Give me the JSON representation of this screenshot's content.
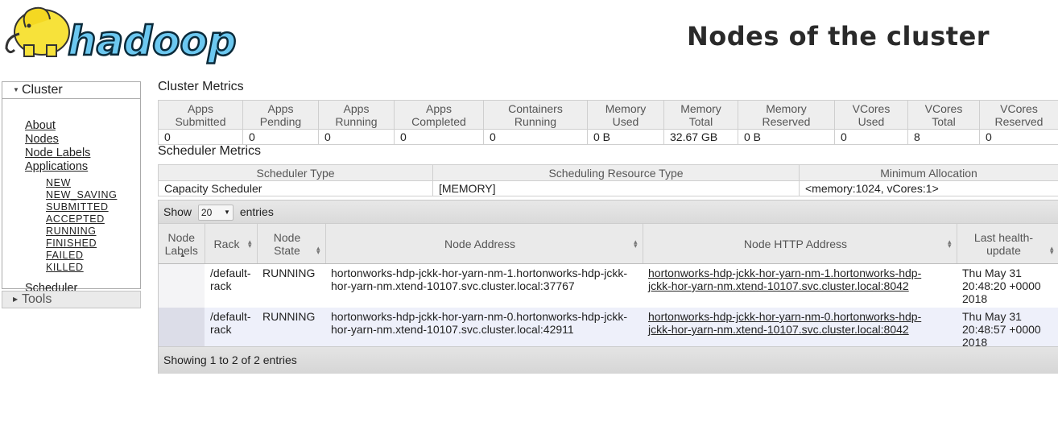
{
  "header": {
    "title": "Nodes of the cluster",
    "logo_text": "hadoop"
  },
  "sidebar": {
    "cluster_label": "Cluster",
    "links": [
      "About",
      "Nodes",
      "Node Labels",
      "Applications"
    ],
    "app_states": [
      "NEW",
      "NEW_SAVING",
      "SUBMITTED",
      "ACCEPTED",
      "RUNNING",
      "FINISHED",
      "FAILED",
      "KILLED"
    ],
    "scheduler_label": "Scheduler",
    "tools_label": "Tools"
  },
  "cluster_metrics": {
    "title": "Cluster Metrics",
    "headers": [
      [
        "Apps",
        "Submitted"
      ],
      [
        "Apps",
        "Pending"
      ],
      [
        "Apps",
        "Running"
      ],
      [
        "Apps",
        "Completed"
      ],
      [
        "Containers",
        "Running"
      ],
      [
        "Memory",
        "Used"
      ],
      [
        "Memory",
        "Total"
      ],
      [
        "Memory",
        "Reserved"
      ],
      [
        "VCores",
        "Used"
      ],
      [
        "VCores",
        "Total"
      ],
      [
        "VCores",
        "Reserved"
      ]
    ],
    "values": [
      "0",
      "0",
      "0",
      "0",
      "0",
      "0 B",
      "32.67 GB",
      "0 B",
      "0",
      "8",
      "0"
    ]
  },
  "scheduler_metrics": {
    "title": "Scheduler Metrics",
    "headers": [
      "Scheduler Type",
      "Scheduling Resource Type",
      "Minimum Allocation"
    ],
    "values": [
      "Capacity Scheduler",
      "[MEMORY]",
      "<memory:1024, vCores:1>"
    ]
  },
  "nodes_table": {
    "show_label": "Show",
    "page_size": "20",
    "entries_label": "entries",
    "columns": [
      [
        "Node",
        "Labels"
      ],
      [
        "Rack"
      ],
      [
        "Node",
        "State"
      ],
      [
        "Node Address"
      ],
      [
        "Node HTTP Address"
      ],
      [
        "Last health-",
        "update"
      ]
    ],
    "rows": [
      {
        "labels": "",
        "rack": [
          "/default-",
          "rack"
        ],
        "state": "RUNNING",
        "address": [
          "hortonworks-hdp-jckk-hor-yarn-nm-1.hortonworks-hdp-jckk-",
          "hor-yarn-nm.xtend-10107.svc.cluster.local:37767"
        ],
        "http": [
          "hortonworks-hdp-jckk-hor-yarn-nm-1.hortonworks-hdp-",
          "jckk-hor-yarn-nm.xtend-10107.svc.cluster.local:8042"
        ],
        "health": [
          "Thu May 31",
          "20:48:20 +0000",
          "2018"
        ]
      },
      {
        "labels": "",
        "rack": [
          "/default-",
          "rack"
        ],
        "state": "RUNNING",
        "address": [
          "hortonworks-hdp-jckk-hor-yarn-nm-0.hortonworks-hdp-jckk-",
          "hor-yarn-nm.xtend-10107.svc.cluster.local:42911"
        ],
        "http": [
          "hortonworks-hdp-jckk-hor-yarn-nm-0.hortonworks-hdp-",
          "jckk-hor-yarn-nm.xtend-10107.svc.cluster.local:8042"
        ],
        "health": [
          "Thu May 31",
          "20:48:57 +0000",
          "2018"
        ]
      }
    ],
    "footer": "Showing 1 to 2 of 2 entries"
  }
}
